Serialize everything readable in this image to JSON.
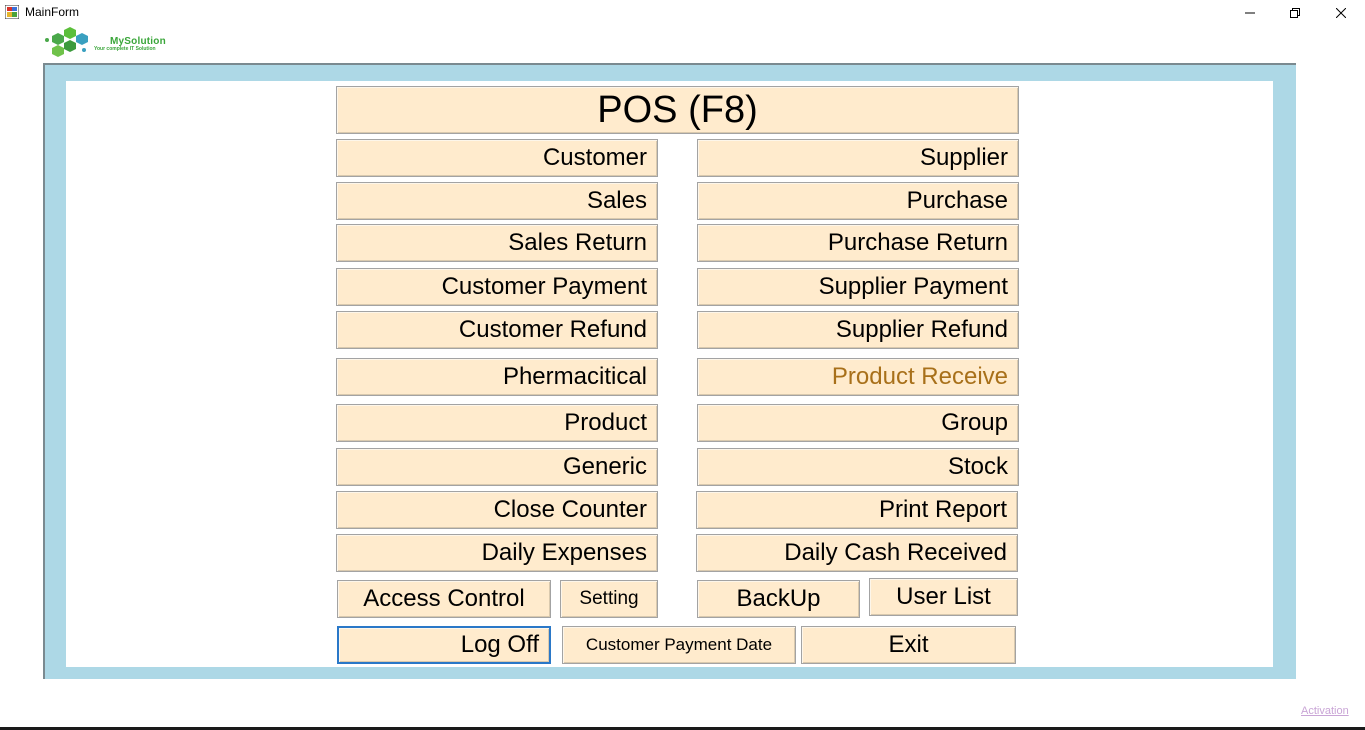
{
  "window": {
    "title": "MainForm",
    "controls": {
      "minimize_icon": "minimize-icon",
      "restore_icon": "restore-icon",
      "close_icon": "close-icon"
    }
  },
  "logo": {
    "name": "MySolution",
    "tagline": "Your complete IT Solution"
  },
  "buttons": {
    "pos": "POS (F8)",
    "customer": "Customer",
    "supplier": "Supplier",
    "sales": "Sales",
    "purchase": "Purchase",
    "sales_return": "Sales Return",
    "purchase_return": "Purchase Return",
    "customer_payment": "Customer Payment",
    "supplier_payment": "Supplier Payment",
    "customer_refund": "Customer Refund",
    "supplier_refund": "Supplier Refund",
    "phermacitical": "Phermacitical",
    "product_receive": "Product Receive",
    "product": "Product",
    "group": "Group",
    "generic": "Generic",
    "stock": "Stock",
    "close_counter": "Close Counter",
    "print_report": "Print Report",
    "daily_expenses": "Daily Expenses",
    "daily_cash_received": "Daily Cash Received",
    "access_control": "Access Control",
    "setting": "Setting",
    "backup": "BackUp",
    "user_list": "User List",
    "log_off": "Log Off",
    "customer_payment_date": "Customer Payment Date",
    "exit": "Exit"
  },
  "footer": {
    "activation_link": "Activation"
  },
  "colors": {
    "button_bg": "#ffebcd",
    "panel_bg": "#add8e6",
    "highlight_text": "#a8701a",
    "focus_border": "#2a78c8"
  }
}
